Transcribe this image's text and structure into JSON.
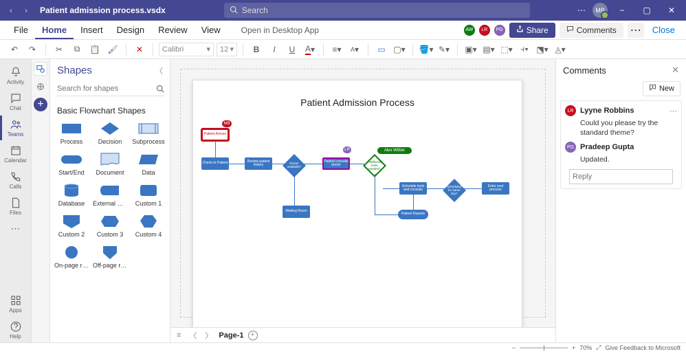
{
  "title_bar": {
    "file_name": "Patient admission process.vsdx",
    "search_placeholder": "Search",
    "user_initials": "MB"
  },
  "ribbon": {
    "tabs": [
      "File",
      "Home",
      "Insert",
      "Design",
      "Review",
      "View"
    ],
    "active_tab": "Home",
    "open_desktop": "Open in Desktop App",
    "share": "Share",
    "comments": "Comments",
    "close": "Close",
    "presence": [
      {
        "initials": "AW",
        "cls": "p-green"
      },
      {
        "initials": "LR",
        "cls": "p-red"
      },
      {
        "initials": "PG",
        "cls": "p-purple"
      }
    ]
  },
  "toolbar": {
    "font_name": "Calibri",
    "font_size": "12"
  },
  "rail": {
    "items": [
      {
        "label": "Activity"
      },
      {
        "label": "Chat"
      },
      {
        "label": "Teams"
      },
      {
        "label": "Calendar"
      },
      {
        "label": "Calls"
      },
      {
        "label": "Files"
      }
    ],
    "bottom": [
      {
        "label": "Apps"
      },
      {
        "label": "Help"
      }
    ]
  },
  "shapes": {
    "panel_title": "Shapes",
    "search_placeholder": "Search for shapes",
    "category_title": "Basic Flowchart Shapes",
    "items": [
      {
        "label": "Process"
      },
      {
        "label": "Decision"
      },
      {
        "label": "Subprocess"
      },
      {
        "label": "Start/End"
      },
      {
        "label": "Document"
      },
      {
        "label": "Data"
      },
      {
        "label": "Database"
      },
      {
        "label": "External Data"
      },
      {
        "label": "Custom 1"
      },
      {
        "label": "Custom 2"
      },
      {
        "label": "Custom 3"
      },
      {
        "label": "Custom 4"
      },
      {
        "label": "On-page ref..."
      },
      {
        "label": "Off-page ref..."
      }
    ]
  },
  "diagram": {
    "title": "Patient Admission Process",
    "cursors": {
      "mb": "MB",
      "lr": "LR",
      "aw": "Alex Wilber"
    },
    "nodes": {
      "arrives": "Patient Arrives",
      "checkin": "Check-In Patient",
      "history": "Review patient history",
      "doctor_avail": "Doctor available?",
      "consult": "Patient consults doctor",
      "addl": "Additional tests needed?",
      "waiting": "Waiting Room",
      "schedule": "Schedule tests and consults",
      "same_day": "Scheduled for same day?",
      "enter": "Enter next process",
      "departs": "Patient Departs"
    }
  },
  "page_tabs": {
    "current": "Page-1"
  },
  "comments": {
    "title": "Comments",
    "new_label": "New",
    "thread": {
      "user1": {
        "initials": "LR",
        "name": "Lyyne Robbins",
        "color": "#c50f1f"
      },
      "body1": "Could you please try the standard theme?",
      "user2": {
        "initials": "PG",
        "name": "Pradeep Gupta",
        "color": "#8764b8"
      },
      "body2": "Updated."
    },
    "reply_placeholder": "Reply"
  },
  "status": {
    "zoom": "70%",
    "feedback": "Give Feedback to Microsoft"
  }
}
